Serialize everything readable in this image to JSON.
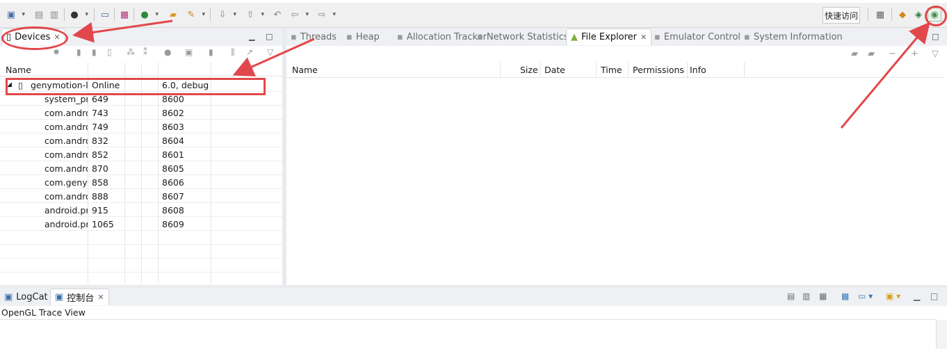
{
  "toolbar": {
    "quick_access_label": "快速访问",
    "icons": [
      "new-icon",
      "save-icon",
      "save-all-icon",
      "profile-icon",
      "sdk-manager-icon",
      "avd-manager-icon",
      "run-icon",
      "open-folder-icon",
      "tools-icon",
      "download-icon",
      "upload-icon",
      "back-icon",
      "forward-icon",
      "open-perspective-icon",
      "debug-perspective-icon",
      "ddms-perspective-icon",
      "genymotion-icon"
    ]
  },
  "devices_panel": {
    "tab_label": "Devices",
    "column_name": "Name",
    "device": {
      "name": "genymotion-la",
      "status": "Online",
      "version": "6.0, debug"
    },
    "processes": [
      {
        "name": "system_prc",
        "pid": "649",
        "port": "8600"
      },
      {
        "name": "com.andro",
        "pid": "743",
        "port": "8602"
      },
      {
        "name": "com.andro",
        "pid": "749",
        "port": "8603"
      },
      {
        "name": "com.andro",
        "pid": "832",
        "port": "8604"
      },
      {
        "name": "com.andro",
        "pid": "852",
        "port": "8601"
      },
      {
        "name": "com.andro",
        "pid": "870",
        "port": "8605"
      },
      {
        "name": "com.genyn",
        "pid": "858",
        "port": "8606"
      },
      {
        "name": "com.andro",
        "pid": "888",
        "port": "8607"
      },
      {
        "name": "android.pr",
        "pid": "915",
        "port": "8608"
      },
      {
        "name": "android.pr",
        "pid": "1065",
        "port": "8609"
      }
    ]
  },
  "right_panel": {
    "tabs": [
      {
        "label": "Threads",
        "icon": "threads-icon"
      },
      {
        "label": "Heap",
        "icon": "heap-icon"
      },
      {
        "label": "Allocation Tracker",
        "icon": "allocation-icon"
      },
      {
        "label": "Network Statistics",
        "icon": "network-icon"
      },
      {
        "label": "File Explorer",
        "icon": "android-icon",
        "active": true
      },
      {
        "label": "Emulator Control",
        "icon": "emulator-icon"
      },
      {
        "label": "System Information",
        "icon": "sysinfo-icon"
      }
    ],
    "columns": [
      "Name",
      "Size",
      "Date",
      "Time",
      "Permissions",
      "Info"
    ]
  },
  "bottom_panel": {
    "tabs": [
      {
        "label": "LogCat",
        "icon": "logcat-icon"
      },
      {
        "label": "控制台",
        "icon": "console-icon",
        "active": true
      }
    ],
    "content_text": "OpenGL Trace View"
  },
  "colors": {
    "annotation": "#e2474b",
    "accent": "#4a6fa5"
  }
}
